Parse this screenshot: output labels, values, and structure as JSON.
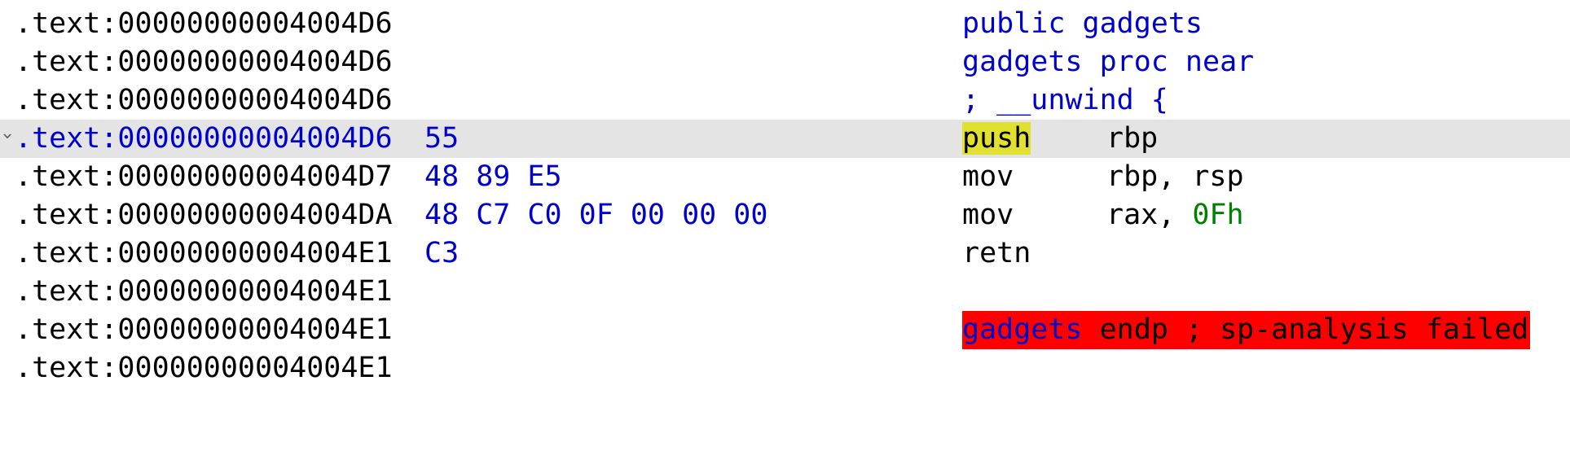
{
  "listing": {
    "rows": [
      {
        "address": ".text:00000000004004D6",
        "bytes": "",
        "code": "public gadgets"
      },
      {
        "address": ".text:00000000004004D6",
        "bytes": "",
        "code": "gadgets proc near"
      },
      {
        "address": ".text:00000000004004D6",
        "bytes": "",
        "code": "; __unwind {"
      },
      {
        "address": ".text:00000000004004D6",
        "bytes": "55",
        "mnemonic": "push",
        "operands": "rbp"
      },
      {
        "address": ".text:00000000004004D7",
        "bytes": "48 89 E5",
        "mnemonic": "mov",
        "operands": "rbp, rsp"
      },
      {
        "address": ".text:00000000004004DA",
        "bytes": "48 C7 C0 0F 00 00 00",
        "mnemonic": "mov",
        "operands_prefix": "rax, ",
        "operands_imm": "0Fh"
      },
      {
        "address": ".text:00000000004004E1",
        "bytes": "C3",
        "mnemonic": "retn"
      },
      {
        "address": ".text:00000000004004E1",
        "bytes": "",
        "code": ""
      },
      {
        "address": ".text:00000000004004E1",
        "bytes": "",
        "func_name": "gadgets",
        "endp_text": " endp ; sp-analysis failed"
      },
      {
        "address": ".text:00000000004004E1",
        "bytes": "",
        "code": ""
      }
    ],
    "collapse_glyph": "›"
  },
  "colors": {
    "selected_row_bg": "#e4e4e4",
    "name_blue": "#0000cc",
    "immediate_green": "#008000",
    "cursor_highlight_yellow": "#e0e030",
    "error_red": "#ff0000"
  }
}
